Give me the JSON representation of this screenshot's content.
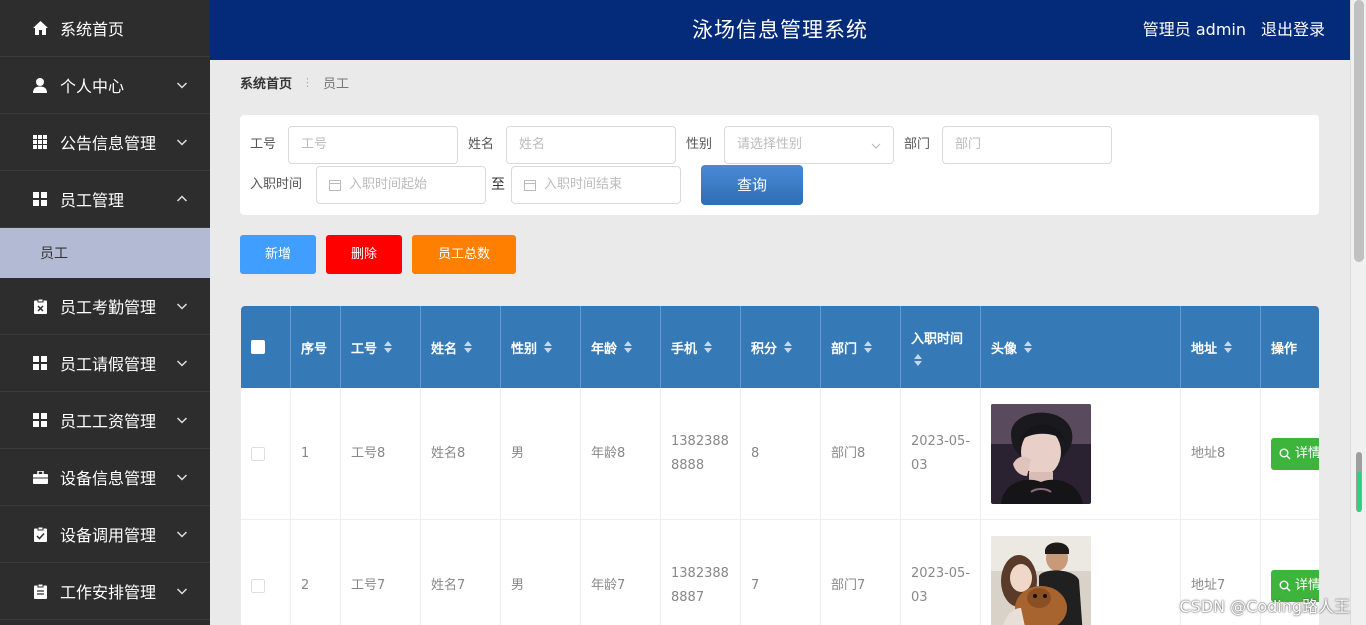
{
  "header": {
    "title": "泳场信息管理系统",
    "user": "管理员 admin",
    "logout": "退出登录",
    "bg_color": "#042a7a"
  },
  "sidebar": {
    "items": [
      {
        "label": "系统首页",
        "icon": "home-icon",
        "chevron": "none"
      },
      {
        "label": "个人中心",
        "icon": "user-icon",
        "chevron": "down"
      },
      {
        "label": "公告信息管理",
        "icon": "grid-icon",
        "chevron": "down"
      },
      {
        "label": "员工管理",
        "icon": "grid-icon",
        "chevron": "up"
      },
      {
        "label": "员工考勤管理",
        "icon": "clipboard-icon",
        "chevron": "down"
      },
      {
        "label": "员工请假管理",
        "icon": "grid-icon",
        "chevron": "down"
      },
      {
        "label": "员工工资管理",
        "icon": "grid-icon",
        "chevron": "down"
      },
      {
        "label": "设备信息管理",
        "icon": "briefcase-icon",
        "chevron": "down"
      },
      {
        "label": "设备调用管理",
        "icon": "clipboard-check-icon",
        "chevron": "down"
      },
      {
        "label": "工作安排管理",
        "icon": "clipboard-icon",
        "chevron": "down"
      }
    ],
    "subitem": "员工"
  },
  "breadcrumb": {
    "home": "系统首页",
    "current": "员工"
  },
  "search": {
    "gonghao_label": "工号",
    "gonghao_placeholder": "工号",
    "name_label": "姓名",
    "name_placeholder": "姓名",
    "gender_label": "性别",
    "gender_placeholder": "请选择性别",
    "dept_label": "部门",
    "dept_placeholder": "部门",
    "date_label": "入职时间",
    "date_start_placeholder": "入职时间起始",
    "date_to": "至",
    "date_end_placeholder": "入职时间结束",
    "query_button": "查询"
  },
  "actions": {
    "add": "新增",
    "delete": "删除",
    "total": "员工总数",
    "add_color": "#409eff",
    "delete_color": "#ff0000",
    "total_color": "#ff8000"
  },
  "table": {
    "columns": [
      "序号",
      "工号",
      "姓名",
      "性别",
      "年龄",
      "手机",
      "积分",
      "部门",
      "入职时间",
      "头像",
      "地址",
      "操作"
    ],
    "rows": [
      {
        "index": "1",
        "gonghao": "工号8",
        "name": "姓名8",
        "gender": "男",
        "age": "年龄8",
        "phone": "13823888888",
        "points": "8",
        "dept": "部门8",
        "date": "2023-05-03",
        "address": "地址8",
        "action": "详情"
      },
      {
        "index": "2",
        "gonghao": "工号7",
        "name": "姓名7",
        "gender": "男",
        "age": "年龄7",
        "phone": "13823888887",
        "points": "7",
        "dept": "部门7",
        "date": "2023-05-03",
        "address": "地址7",
        "action": "详情"
      }
    ],
    "header_color": "#3579b6"
  },
  "watermark": "CSDN @Coding路人王"
}
